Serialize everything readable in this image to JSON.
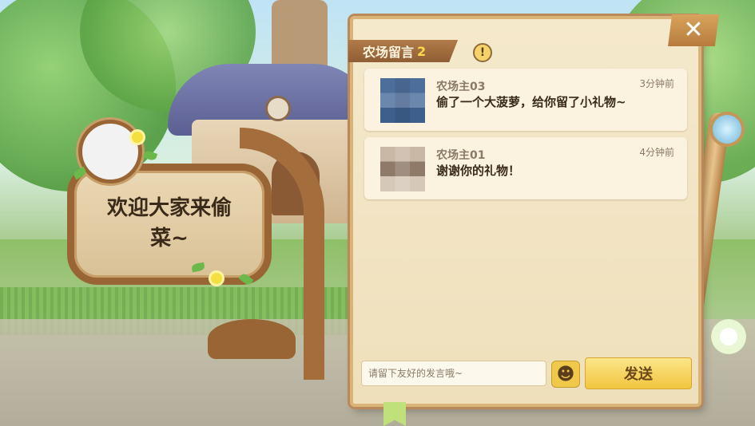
{
  "sign": {
    "text": "欢迎大家来偷菜~"
  },
  "panel": {
    "title": "农场留言",
    "count": "2",
    "info_glyph": "!",
    "close_glyph": "✕"
  },
  "messages": [
    {
      "name": "农场主03",
      "time": "3分钟前",
      "text": "偷了一个大菠萝，给你留了小礼物~",
      "avatar": "blue-pixelated-avatar"
    },
    {
      "name": "农场主01",
      "time": "4分钟前",
      "text": "谢谢你的礼物！",
      "avatar": "tan-pixelated-avatar"
    }
  ],
  "composer": {
    "placeholder": "请留下友好的发言哦~",
    "send_label": "发送",
    "emoji_glyph": "☻"
  },
  "colors": {
    "panel_bg": "#f5e9cc",
    "header_brown": "#8f5e35",
    "send_gold": "#f2c53e",
    "count_yellow": "#ffd94a"
  }
}
